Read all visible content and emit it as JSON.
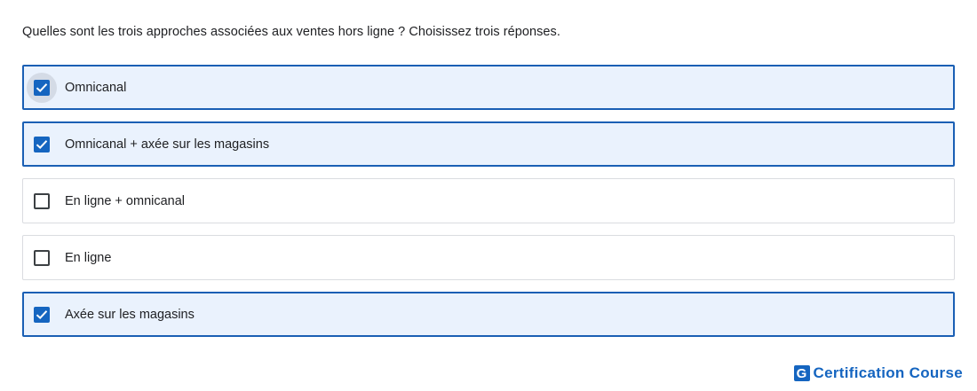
{
  "question": "Quelles sont les trois approches associées aux ventes hors ligne ? Choisissez trois réponses.",
  "options": [
    {
      "label": "Omnicanal",
      "checked": true,
      "focused": true
    },
    {
      "label": "Omnicanal + axée sur les magasins",
      "checked": true,
      "focused": false
    },
    {
      "label": "En ligne + omnicanal",
      "checked": false,
      "focused": false
    },
    {
      "label": "En ligne",
      "checked": false,
      "focused": false
    },
    {
      "label": "Axée sur les magasins",
      "checked": true,
      "focused": false
    }
  ],
  "brand": {
    "logo_letter": "G",
    "text": "Certification Course"
  },
  "colors": {
    "accent": "#1565c0",
    "selected_border": "#1a5fb4",
    "selected_background": "#eaf2fd",
    "unselected_border": "#dadce0"
  }
}
